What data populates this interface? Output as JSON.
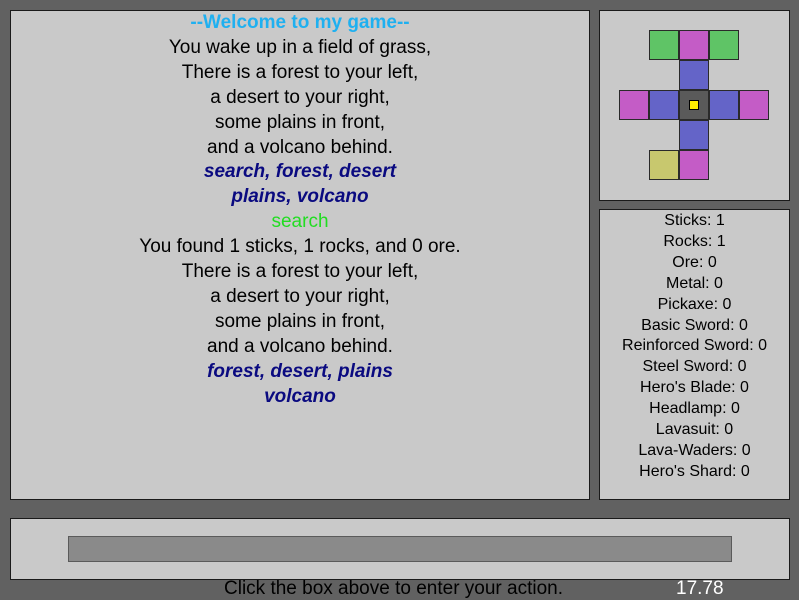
{
  "log": [
    {
      "text": "--Welcome to my game--",
      "style": "title"
    },
    {
      "text": "You wake up in a field of grass,",
      "style": "normal"
    },
    {
      "text": "There is a forest to your left,",
      "style": "normal"
    },
    {
      "text": "a desert to your right,",
      "style": "normal"
    },
    {
      "text": "some plains in front,",
      "style": "normal"
    },
    {
      "text": "and a volcano behind.",
      "style": "normal"
    },
    {
      "text": "search, forest, desert",
      "style": "choice"
    },
    {
      "text": "plains, volcano",
      "style": "choice"
    },
    {
      "text": "search",
      "style": "echo"
    },
    {
      "text": "You found 1 sticks, 1 rocks, and 0 ore.",
      "style": "normal"
    },
    {
      "text": "There is a forest to your left,",
      "style": "normal"
    },
    {
      "text": "a desert to your right,",
      "style": "normal"
    },
    {
      "text": "some plains in front,",
      "style": "normal"
    },
    {
      "text": "and a volcano behind.",
      "style": "normal"
    },
    {
      "text": "forest, desert, plains",
      "style": "choice"
    },
    {
      "text": "volcano",
      "style": "choice"
    }
  ],
  "map": {
    "colors": {
      "forest": "#5fc466",
      "plains": "#c45cc6",
      "path": "#6464c8",
      "desert": "#c8c86e",
      "current": "#5a5a5a",
      "player": "#ffee00"
    },
    "tiles": [
      {
        "col": 0,
        "row": 0,
        "type": "forest"
      },
      {
        "col": 1,
        "row": 0,
        "type": "plains"
      },
      {
        "col": 2,
        "row": 0,
        "type": "forest"
      },
      {
        "col": 1,
        "row": 1,
        "type": "path"
      },
      {
        "col": -1,
        "row": 2,
        "type": "plains"
      },
      {
        "col": 0,
        "row": 2,
        "type": "path"
      },
      {
        "col": 1,
        "row": 2,
        "type": "current"
      },
      {
        "col": 2,
        "row": 2,
        "type": "path"
      },
      {
        "col": 3,
        "row": 2,
        "type": "plains"
      },
      {
        "col": 1,
        "row": 3,
        "type": "path"
      },
      {
        "col": 0,
        "row": 4,
        "type": "desert"
      },
      {
        "col": 1,
        "row": 4,
        "type": "plains"
      }
    ]
  },
  "inventory": [
    "Sticks: 1",
    "Rocks: 1",
    "Ore: 0",
    "Metal: 0",
    "Pickaxe: 0",
    "Basic Sword: 0",
    "Reinforced Sword: 0",
    "Steel Sword: 0",
    "Hero's Blade: 0",
    "Headlamp: 0",
    "Lavasuit: 0",
    "Lava-Waders: 0",
    "Hero's Shard: 0"
  ],
  "input": {
    "value": "",
    "placeholder": ""
  },
  "hint": "Click the box above to enter your action.",
  "timer": "17.78"
}
